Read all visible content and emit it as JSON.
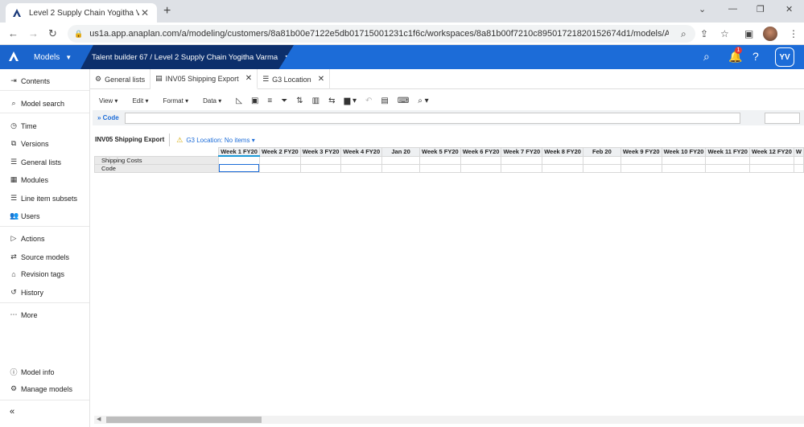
{
  "browser": {
    "tab_title": "Level 2 Supply Chain Yogitha Var",
    "url": "us1a.app.anaplan.com/a/modeling/customers/8a81b00e7122e5db01715001231c1f6c/workspaces/8a81b00f7210c89501721820152674d1/models/A0..."
  },
  "appbar": {
    "models_label": "Models",
    "breadcrumb": "Talent builder 67 / Level 2 Supply Chain Yogitha Varma",
    "notification_count": "1",
    "user_initials": "YV"
  },
  "sidebar": {
    "items": [
      {
        "label": "Contents",
        "icon": "contents-icon"
      },
      {
        "label": "Model search",
        "icon": "search-icon"
      },
      {
        "label": "Time",
        "icon": "clock-icon"
      },
      {
        "label": "Versions",
        "icon": "versions-icon"
      },
      {
        "label": "General lists",
        "icon": "list-icon"
      },
      {
        "label": "Modules",
        "icon": "modules-icon"
      },
      {
        "label": "Line item subsets",
        "icon": "list-icon"
      },
      {
        "label": "Users",
        "icon": "users-icon"
      },
      {
        "label": "Actions",
        "icon": "play-icon"
      },
      {
        "label": "Source models",
        "icon": "share-icon"
      },
      {
        "label": "Revision tags",
        "icon": "tag-icon"
      },
      {
        "label": "History",
        "icon": "history-icon"
      },
      {
        "label": "More",
        "icon": "more-icon"
      },
      {
        "label": "Model info",
        "icon": "info-icon"
      },
      {
        "label": "Manage models",
        "icon": "gear-icon"
      }
    ]
  },
  "tabs": [
    {
      "label": "General lists",
      "icon": "gear-icon",
      "closable": false
    },
    {
      "label": "INV05 Shipping Export",
      "icon": "module-icon",
      "closable": true
    },
    {
      "label": "G3 Location",
      "icon": "list-icon",
      "closable": true
    }
  ],
  "toolbar": {
    "view": "View",
    "edit": "Edit",
    "format": "Format",
    "data": "Data"
  },
  "formula": {
    "label": "Code"
  },
  "grid": {
    "title": "INV05 Shipping Export",
    "page_selector": "G3 Location: No items",
    "columns": [
      "Week 1 FY20",
      "Week 2 FY20",
      "Week 3 FY20",
      "Week 4 FY20",
      "Jan 20",
      "Week 5 FY20",
      "Week 6 FY20",
      "Week 7 FY20",
      "Week 8 FY20",
      "Feb 20",
      "Week 9 FY20",
      "Week 10 FY20",
      "Week 11 FY20",
      "Week 12 FY20",
      "W"
    ],
    "rows": [
      "Shipping Costs",
      "Code"
    ]
  }
}
